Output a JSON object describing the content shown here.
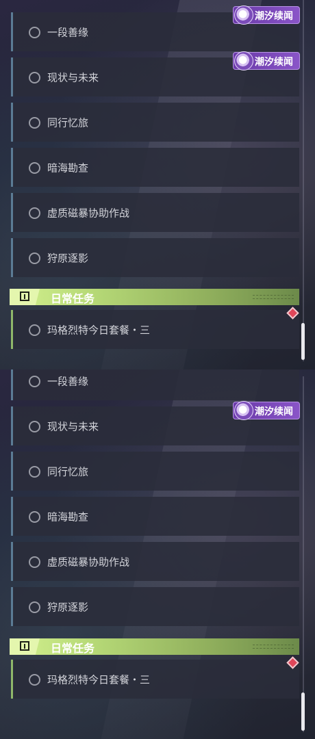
{
  "badge": {
    "text": "潮汐续闻"
  },
  "quests": [
    {
      "label": "一段善缘"
    },
    {
      "label": "现状与未来"
    },
    {
      "label": "同行忆旅"
    },
    {
      "label": "暗海勘查"
    },
    {
      "label": "虚质磁暴协助作战"
    },
    {
      "label": "狩原逐影"
    }
  ],
  "daily": {
    "title": "日常任务",
    "items": [
      {
        "label": "玛格烈特今日套餐・三"
      }
    ]
  },
  "icons": {
    "radio": "radio-unchecked-icon",
    "warning": "exclamation-box-icon",
    "badge": "wuthering-waves-logo-icon",
    "marker": "red-diamond-marker-icon"
  },
  "colors": {
    "item_bg": "#2a2c3a",
    "item_border": "#5c7c95",
    "daily_header": "#b5d876",
    "badge": "#7a48b8",
    "marker": "#e0465a"
  }
}
